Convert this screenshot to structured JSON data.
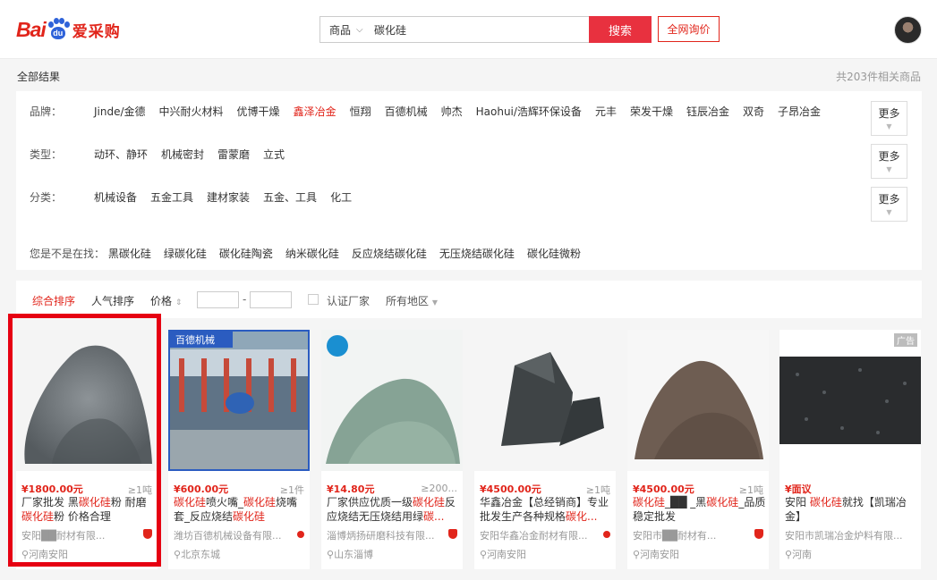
{
  "header": {
    "logo_bai": "Bai",
    "logo_du": "du",
    "logo_brand": "爱采购",
    "search_category": "商品",
    "search_query": "碳化硅",
    "search_button": "搜索",
    "inquiry_button": "全网询价"
  },
  "results": {
    "all_label": "全部结果",
    "count_text": "共203件相关商品"
  },
  "filters": {
    "brand_label": "品牌：",
    "brands": [
      "Jinde/金德",
      "中兴耐火材料",
      "优博干燥",
      "鑫泽冶金",
      "恒翔",
      "百德机械",
      "帅杰",
      "Haohui/浩辉环保设备",
      "元丰",
      "荣发干燥",
      "钰辰冶金",
      "双奇",
      "子昂冶金"
    ],
    "type_label": "类型：",
    "types": [
      "动环、静环",
      "机械密封",
      "雷蒙磨",
      "立式"
    ],
    "category_label": "分类：",
    "categories": [
      "机械设备",
      "五金工具",
      "建材家装",
      "五金、工具",
      "化工"
    ],
    "more_label": "更多",
    "suggest_label": "您是不是在找：",
    "suggestions": [
      "黑碳化硅",
      "绿碳化硅",
      "碳化硅陶瓷",
      "纳米碳化硅",
      "反应烧结碳化硅",
      "无压烧结碳化硅",
      "碳化硅微粉"
    ]
  },
  "sortbar": {
    "comprehensive": "综合排序",
    "popularity": "人气排序",
    "price": "价格",
    "price_sep": "-",
    "certified": "认证厂家",
    "region": "所有地区"
  },
  "products": [
    {
      "price": "¥1800.00元",
      "moq": "≥1吨",
      "title_parts": [
        "厂家批发 黑",
        "碳化硅",
        "粉 耐磨",
        "碳化硅",
        "粉 价格合理"
      ],
      "shop": "安阳██耐材有限...",
      "loc": "河南安阳"
    },
    {
      "price": "¥600.00元",
      "moq": "≥1件",
      "title_parts": [
        "",
        "碳化硅",
        "喷火嘴_",
        "碳化硅",
        "烧嘴套_反应烧结",
        "碳化硅",
        ""
      ],
      "shop": "潍坊百德机械设备有限...",
      "loc": "北京东城",
      "badge": "百德机械"
    },
    {
      "price": "¥14.80元",
      "moq": "≥200...",
      "title_parts": [
        "厂家供应优质一级",
        "碳化硅",
        "反应烧结无压烧结用绿",
        "碳...",
        ""
      ],
      "shop": "淄博炳扬研磨科技有限...",
      "loc": "山东淄博"
    },
    {
      "price": "¥4500.00元",
      "moq": "≥1吨",
      "title_parts": [
        "华鑫冶金【总经销商】专业批发生产各种规格",
        "碳化...",
        ""
      ],
      "shop": "安阳华鑫冶金耐材有限...",
      "loc": "河南安阳"
    },
    {
      "price": "¥4500.00元",
      "moq": "≥1吨",
      "title_parts": [
        "",
        "碳化硅",
        "_██ _黑",
        "碳化硅",
        "_品质稳定批发"
      ],
      "shop": "安阳市██耐材有...",
      "loc": "河南安阳"
    },
    {
      "price": "¥面议",
      "moq": "",
      "title_parts": [
        "安阳 ",
        "碳化硅",
        "就找【凯瑞冶金】"
      ],
      "shop": "安阳市凯瑞冶金炉料有限...",
      "loc": "河南",
      "ad": "广告"
    }
  ],
  "colors": {
    "accent": "#e1251b",
    "search_button": "#e8313f",
    "selection": "#e60012"
  }
}
